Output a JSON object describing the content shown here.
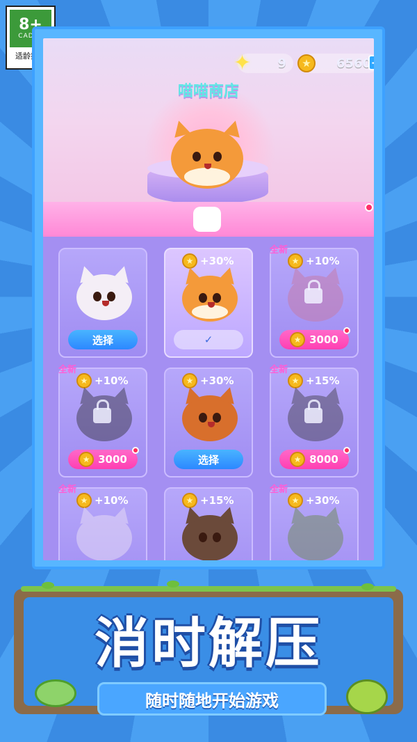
{
  "rating": {
    "age": "8+",
    "org": "CADPA",
    "tip": "适龄提示"
  },
  "header": {
    "stars": "9",
    "coins": "6560",
    "plus": "+"
  },
  "shop": {
    "title": "喵喵商店"
  },
  "cards": [
    {
      "bonus": "",
      "new": "",
      "action": "选择",
      "state": "select"
    },
    {
      "bonus": "+30%",
      "new": "",
      "action": "✓",
      "state": "checked"
    },
    {
      "bonus": "+10%",
      "new": "全新",
      "action": "3000",
      "state": "price"
    },
    {
      "bonus": "+10%",
      "new": "全新",
      "action": "3000",
      "state": "price"
    },
    {
      "bonus": "+30%",
      "new": "",
      "action": "选择",
      "state": "select"
    },
    {
      "bonus": "+15%",
      "new": "全新",
      "action": "8000",
      "state": "price"
    },
    {
      "bonus": "+10%",
      "new": "全新",
      "action": "",
      "state": "locked"
    },
    {
      "bonus": "+15%",
      "new": "",
      "action": "",
      "state": "owned"
    },
    {
      "bonus": "+30%",
      "new": "全新",
      "action": "",
      "state": "locked"
    }
  ],
  "banner": {
    "headline": "消时解压",
    "subtitle": "随时随地开始游戏"
  },
  "colors": {
    "accent": "#3b8fe6",
    "pink": "#ff4fb8",
    "coin": "#f6b91d"
  }
}
